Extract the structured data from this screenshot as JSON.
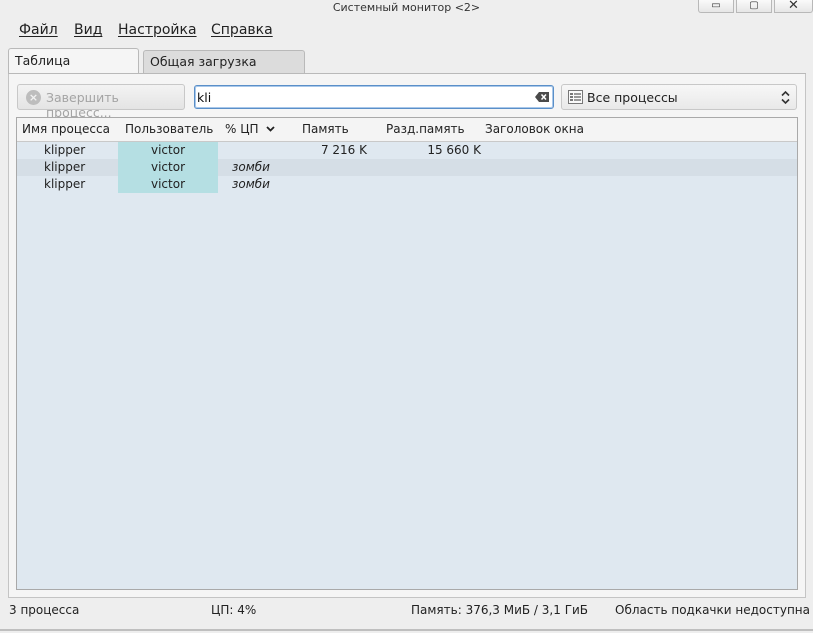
{
  "window": {
    "title": "Системный монитор <2>",
    "minimize_glyph": "▭",
    "maximize_glyph": "▢",
    "close_glyph": "✕"
  },
  "menu": {
    "items": [
      "Файл",
      "Вид",
      "Настройка",
      "Справка"
    ]
  },
  "tabs": [
    {
      "label": "Таблица процессов",
      "active": true
    },
    {
      "label": "Общая загрузка системы",
      "active": false
    }
  ],
  "toolbar": {
    "end_process_label": "Завершить процесс...",
    "end_process_enabled": false,
    "search_value": "kli",
    "filter_selected": "Все процессы"
  },
  "table": {
    "columns": [
      "Имя процесса",
      "Пользователь",
      "% ЦП",
      "Память",
      "Разд.память",
      "Заголовок окна"
    ],
    "sort_column": "% ЦП",
    "rows": [
      {
        "name": "klipper",
        "user": "victor",
        "cpu": "",
        "memory": "7 216 K",
        "shared": "15 660 K",
        "window_title": ""
      },
      {
        "name": "klipper",
        "user": "victor",
        "cpu": "зомби",
        "memory": "",
        "shared": "",
        "window_title": ""
      },
      {
        "name": "klipper",
        "user": "victor",
        "cpu": "зомби",
        "memory": "",
        "shared": "",
        "window_title": ""
      }
    ]
  },
  "status": {
    "process_count": "3 процесса",
    "cpu": "ЦП: 4%",
    "memory": "Память: 376,3 МиБ / 3,1 ГиБ",
    "swap": "Область подкачки недоступна"
  },
  "colors": {
    "table_bg": "#dfe8f0",
    "user_column_highlight": "#b5dfe3",
    "search_focus": "#5a8fc8"
  }
}
